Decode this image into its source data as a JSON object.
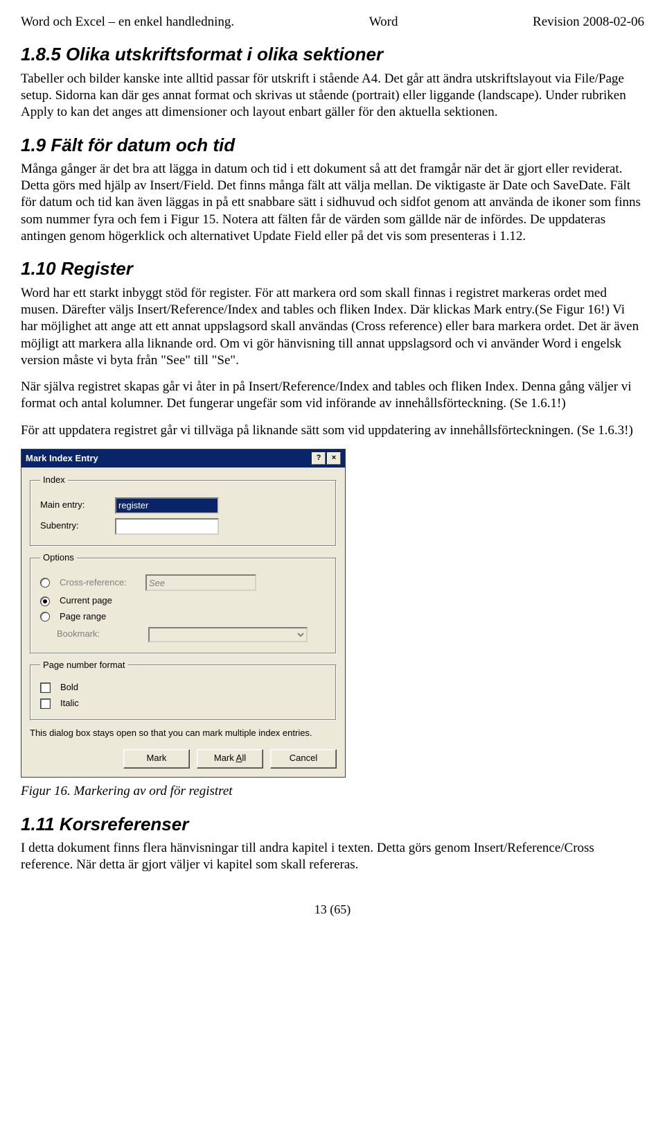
{
  "header": {
    "left": "Word och Excel – en enkel handledning.",
    "center": "Word",
    "right": "Revision 2008-02-06"
  },
  "sections": {
    "s185": {
      "title": "1.8.5 Olika utskriftsformat i olika sektioner",
      "p": "Tabeller och bilder kanske inte alltid passar för utskrift i stående A4. Det går att ändra utskriftslayout via File/Page setup. Sidorna kan där ges annat format och skrivas ut stående (portrait) eller liggande (landscape). Under rubriken Apply to kan det anges att dimensioner och layout enbart gäller för den aktuella sektionen."
    },
    "s19": {
      "title": "1.9 Fält för datum och tid",
      "p": "Många gånger är det bra att lägga in datum och tid i ett dokument så att det framgår när det är gjort eller reviderat. Detta görs med hjälp av Insert/Field. Det finns många fält att välja mellan. De viktigaste är Date och SaveDate. Fält för datum och tid kan även läggas in på ett snabbare sätt i sidhuvud och sidfot genom att använda de ikoner som finns som nummer fyra och fem i Figur 15. Notera att fälten får de värden som gällde när de infördes. De uppdateras antingen genom högerklick och alternativet Update Field eller på det vis som presenteras i 1.12."
    },
    "s110": {
      "title": "1.10 Register",
      "p1": "Word har ett starkt inbyggt stöd för register. För att markera ord som skall finnas i registret markeras ordet med musen. Därefter väljs Insert/Reference/Index and tables och fliken Index. Där klickas Mark entry.(Se Figur 16!) Vi har möjlighet att ange att ett annat uppslagsord skall användas (Cross reference) eller bara markera ordet. Det är även möjligt att markera alla liknande ord. Om vi gör hänvisning till annat uppslagsord och vi använder Word i engelsk version måste vi byta från \"See\" till \"Se\".",
      "p2": "När själva registret skapas går vi åter in på Insert/Reference/Index and tables och fliken Index. Denna gång väljer vi format och antal kolumner. Det fungerar ungefär som vid införande av innehållsförteckning. (Se 1.6.1!)",
      "p3": "För att uppdatera registret går vi tillväga på liknande sätt som vid uppdatering av innehållsförteckningen. (Se 1.6.3!)"
    },
    "figcap": "Figur 16. Markering av ord för registret",
    "s111": {
      "title": "1.11 Korsreferenser",
      "p": "I detta dokument finns flera hänvisningar till andra kapitel i texten. Detta görs genom Insert/Reference/Cross reference. När detta är gjort väljer vi kapitel som skall refereras."
    }
  },
  "dialog": {
    "title": "Mark Index Entry",
    "help": "?",
    "close": "×",
    "index_legend": "Index",
    "options_legend": "Options",
    "page_legend": "Page number format",
    "main_label": "Main entry:",
    "main_value": "register",
    "sub_label": "Subentry:",
    "sub_value": "",
    "cross_label": "Cross-reference:",
    "cross_value": "See",
    "current_label": "Current page",
    "range_label": "Page range",
    "bookmark_label": "Bookmark:",
    "bookmark_value": "",
    "bold_label": "Bold",
    "italic_label": "Italic",
    "info": "This dialog box stays open so that you can mark multiple index entries.",
    "btn_mark": "Mark",
    "btn_markall_pre": "Mark ",
    "btn_markall_ul": "A",
    "btn_markall_post": "ll",
    "btn_cancel": "Cancel"
  },
  "footer": {
    "pagenum": "13 (65)"
  }
}
